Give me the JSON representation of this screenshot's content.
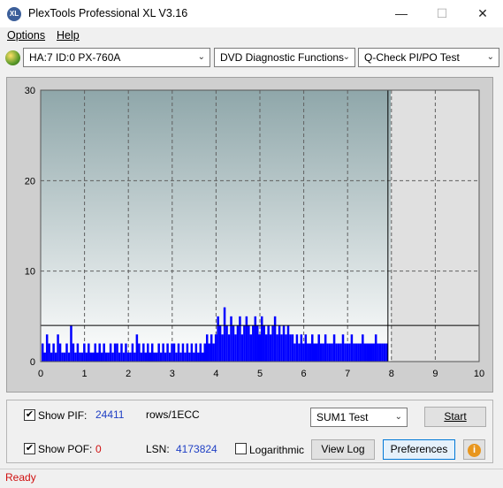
{
  "window": {
    "title": "PlexTools Professional XL V3.16",
    "icon_text": "XL",
    "min_symbol": "—",
    "max_symbol": "☐",
    "close_symbol": "✕"
  },
  "menu": {
    "options": "Options",
    "help": "Help"
  },
  "toolbar": {
    "drive": "HA:7 ID:0  PX-760A",
    "function": "DVD Diagnostic Functions",
    "test": "Q-Check PI/PO Test",
    "chevron": "⌄"
  },
  "chart_data": {
    "type": "bar",
    "xlim": [
      0,
      10
    ],
    "ylim": [
      0,
      30
    ],
    "x_ticks": [
      "0",
      "1",
      "2",
      "3",
      "4",
      "5",
      "6",
      "7",
      "8",
      "9",
      "10"
    ],
    "y_ticks": [
      "0",
      "10",
      "20",
      "30"
    ],
    "grid": true,
    "threshold_line": 4,
    "end_marker_x": 7.92,
    "series": [
      {
        "color": "#0000ff",
        "x": [
          0.05,
          0.1,
          0.15,
          0.2,
          0.25,
          0.3,
          0.35,
          0.4,
          0.45,
          0.5,
          0.55,
          0.6,
          0.65,
          0.7,
          0.75,
          0.8,
          0.85,
          0.9,
          0.95,
          1.0,
          1.05,
          1.1,
          1.15,
          1.2,
          1.25,
          1.3,
          1.35,
          1.4,
          1.45,
          1.5,
          1.55,
          1.6,
          1.65,
          1.7,
          1.75,
          1.8,
          1.85,
          1.9,
          1.95,
          2.0,
          2.05,
          2.1,
          2.15,
          2.2,
          2.25,
          2.3,
          2.35,
          2.4,
          2.45,
          2.5,
          2.55,
          2.6,
          2.65,
          2.7,
          2.75,
          2.8,
          2.85,
          2.9,
          2.95,
          3.0,
          3.05,
          3.1,
          3.15,
          3.2,
          3.25,
          3.3,
          3.35,
          3.4,
          3.45,
          3.5,
          3.55,
          3.6,
          3.65,
          3.7,
          3.75,
          3.8,
          3.85,
          3.9,
          3.95,
          4.0,
          4.05,
          4.1,
          4.15,
          4.2,
          4.25,
          4.3,
          4.35,
          4.4,
          4.45,
          4.5,
          4.55,
          4.6,
          4.65,
          4.7,
          4.75,
          4.8,
          4.85,
          4.9,
          4.95,
          5.0,
          5.05,
          5.1,
          5.15,
          5.2,
          5.25,
          5.3,
          5.35,
          5.4,
          5.45,
          5.5,
          5.55,
          5.6,
          5.65,
          5.7,
          5.75,
          5.8,
          5.85,
          5.9,
          5.95,
          6.0,
          6.05,
          6.1,
          6.15,
          6.2,
          6.25,
          6.3,
          6.35,
          6.4,
          6.45,
          6.5,
          6.55,
          6.6,
          6.65,
          6.7,
          6.75,
          6.8,
          6.85,
          6.9,
          6.95,
          7.0,
          7.05,
          7.1,
          7.15,
          7.2,
          7.25,
          7.3,
          7.35,
          7.4,
          7.45,
          7.5,
          7.55,
          7.6,
          7.65,
          7.7,
          7.75,
          7.8,
          7.85,
          7.9
        ],
        "values": [
          2,
          1,
          3,
          2,
          1,
          2,
          1,
          3,
          2,
          1,
          1,
          2,
          1,
          4,
          2,
          1,
          2,
          1,
          1,
          2,
          1,
          2,
          1,
          1,
          2,
          1,
          2,
          1,
          2,
          1,
          1,
          2,
          1,
          2,
          2,
          1,
          2,
          1,
          2,
          1,
          1,
          2,
          1,
          3,
          2,
          1,
          2,
          1,
          2,
          1,
          2,
          1,
          1,
          2,
          1,
          2,
          1,
          2,
          1,
          2,
          2,
          1,
          2,
          1,
          2,
          1,
          2,
          1,
          2,
          1,
          2,
          1,
          2,
          1,
          2,
          3,
          2,
          3,
          2,
          3,
          5,
          4,
          3,
          6,
          4,
          3,
          5,
          4,
          3,
          4,
          5,
          3,
          4,
          5,
          4,
          3,
          4,
          5,
          4,
          3,
          5,
          4,
          3,
          4,
          3,
          4,
          5,
          3,
          4,
          3,
          4,
          3,
          4,
          3,
          3,
          2,
          3,
          2,
          3,
          2,
          3,
          2,
          2,
          3,
          2,
          2,
          3,
          2,
          2,
          3,
          2,
          2,
          2,
          3,
          2,
          2,
          2,
          3,
          2,
          2,
          2,
          3,
          2,
          2,
          2,
          2,
          3,
          2,
          2,
          2,
          2,
          2,
          3,
          2,
          2,
          2,
          2,
          2
        ]
      }
    ]
  },
  "controls": {
    "show_pif_label": "Show PIF:",
    "pif_value": "24411",
    "pif_unit": "rows/1ECC",
    "show_pof_label": "Show POF:",
    "pof_value": "0",
    "lsn_label": "LSN:",
    "lsn_value": "4173824",
    "logarithmic_label": "Logarithmic",
    "test_select": "SUM1 Test",
    "start_button": "Start",
    "view_log_button": "View Log",
    "preferences_button": "Preferences",
    "check_mark": "✔",
    "info_glyph": "i"
  },
  "status": {
    "text": "Ready"
  }
}
